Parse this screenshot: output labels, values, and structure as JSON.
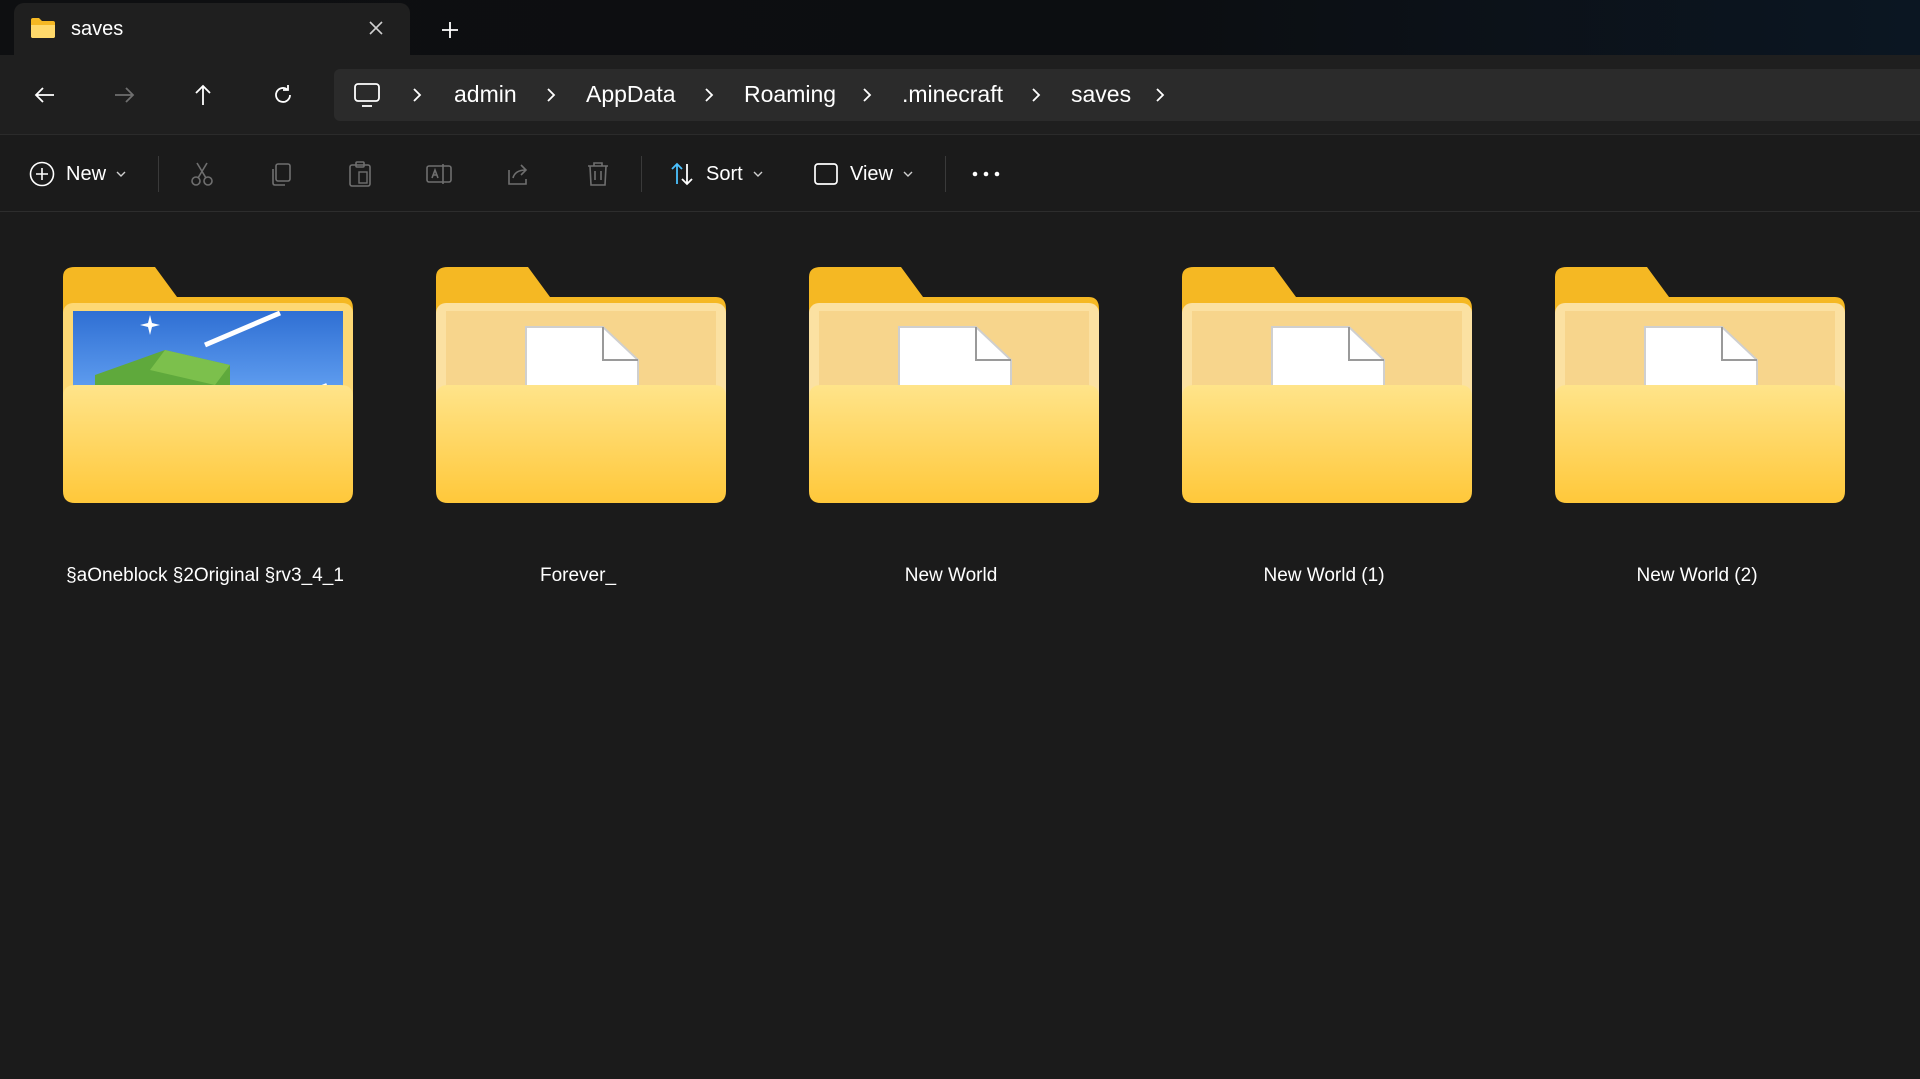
{
  "tab": {
    "title": "saves",
    "folder_icon": "folder-icon",
    "close_icon": "close-icon"
  },
  "new_tab_icon": "plus-icon",
  "nav": {
    "back_icon": "arrow-left-icon",
    "forward_icon": "arrow-right-icon",
    "up_icon": "arrow-up-icon",
    "refresh_icon": "refresh-icon"
  },
  "address": {
    "root_icon": "monitor-icon",
    "crumbs": [
      "admin",
      "AppData",
      "Roaming",
      ".minecraft",
      "saves"
    ]
  },
  "toolbar": {
    "new_label": "New",
    "sort_label": "Sort",
    "view_label": "View",
    "icons": [
      "cut-icon",
      "copy-icon",
      "paste-icon",
      "rename-icon",
      "share-icon",
      "delete-icon",
      "more-icon"
    ]
  },
  "folders": [
    {
      "name": "§aOneblock §2Original §rv3_4_1",
      "thumbnail": "minecraft-world-thumbnail"
    },
    {
      "name": "Forever_",
      "thumbnail": "document-icon"
    },
    {
      "name": "New World",
      "thumbnail": "document-icon"
    },
    {
      "name": "New World (1)",
      "thumbnail": "document-icon"
    },
    {
      "name": "New World (2)",
      "thumbnail": "document-icon"
    }
  ],
  "colors": {
    "background": "#1b1b1b",
    "folder_light": "#ffd96b",
    "folder_dark": "#f5b823",
    "accent": "#4cc2ff"
  }
}
